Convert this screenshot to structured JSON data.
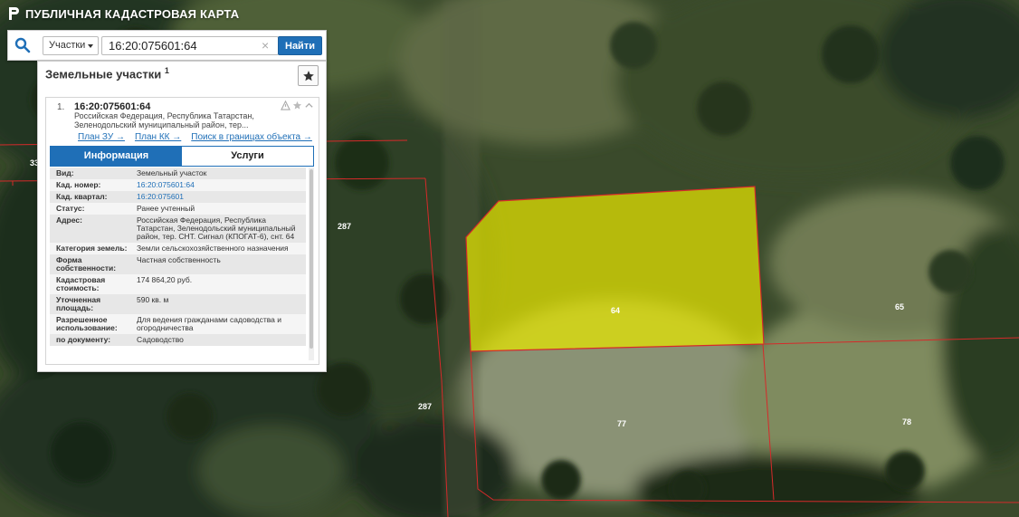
{
  "header": {
    "title": "ПУБЛИЧНАЯ КАДАСТРОВАЯ КАРТА"
  },
  "search": {
    "layer": "Участки",
    "query": "16:20:075601:64",
    "button_label": "Найти",
    "clear_symbol": "×"
  },
  "panel": {
    "title": "Земельные участки",
    "count": "1",
    "result": {
      "index": "1.",
      "cad_number": "16:20:075601:64",
      "address_short": "Российская Федерация, Республика Татарстан, Зеленодольский муниципальный район, тер...",
      "links": [
        "План ЗУ →",
        "План КК →",
        "Поиск в границах объекта →"
      ]
    },
    "tabs": [
      {
        "label": "Информация",
        "active": true
      },
      {
        "label": "Услуги",
        "active": false
      }
    ],
    "properties": [
      {
        "key": "Вид:",
        "value": "Земельный участок"
      },
      {
        "key": "Кад. номер:",
        "value": "16:20:075601:64",
        "link": true
      },
      {
        "key": "Кад. квартал:",
        "value": "16:20:075601",
        "link": true
      },
      {
        "key": "Статус:",
        "value": "Ранее учтенный"
      },
      {
        "key": "Адрес:",
        "value": "Российская Федерация, Республика Татарстан, Зеленодольский муниципальный район, тер. СНТ. Сигнал (КПОГАТ-6), снт. 64"
      },
      {
        "key": "Категория земель:",
        "value": "Земли сельскохозяйственного назначения"
      },
      {
        "key": "Форма собственности:",
        "value": "Частная собственность"
      },
      {
        "key": "Кадастровая стоимость:",
        "value": "174 864,20 руб."
      },
      {
        "key": "Уточненная площадь:",
        "value": "590 кв. м"
      },
      {
        "key": "Разрешенное использование:",
        "value": "Для ведения гражданами садоводства и огородничества"
      },
      {
        "key": "по документу:",
        "value": "Садоводство"
      }
    ]
  },
  "map": {
    "parcel_labels": [
      "64",
      "65",
      "77",
      "78",
      "287",
      "287",
      "33"
    ],
    "colors": {
      "parcel_border": "#d62a2a",
      "selected_fill": "#e6e600",
      "accent": "#1f6fb7"
    }
  }
}
